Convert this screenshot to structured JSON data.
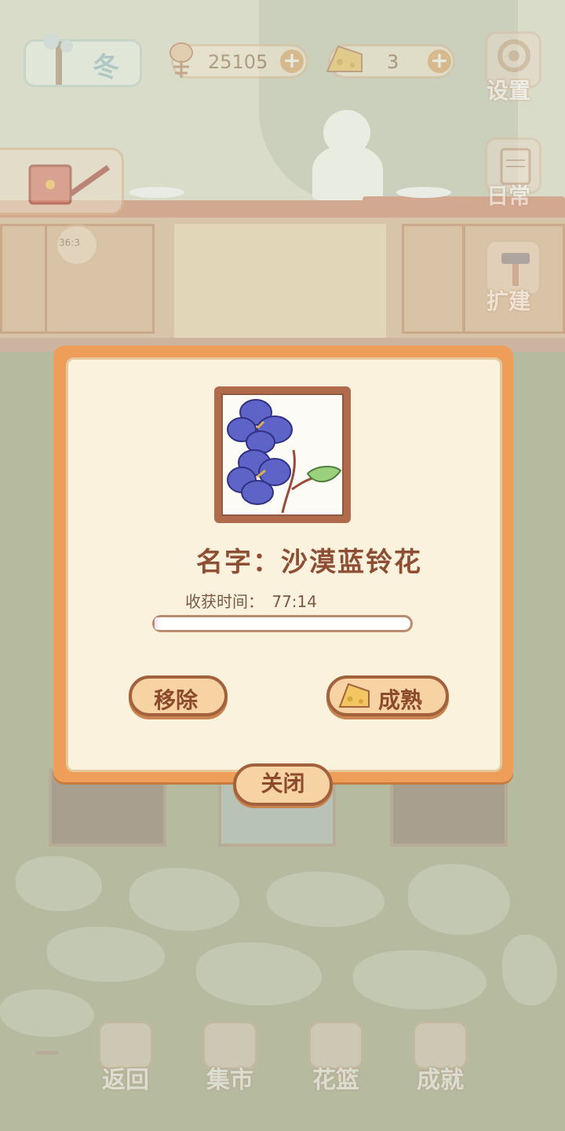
{
  "hud": {
    "season": "冬",
    "fish_count": "25105",
    "cheese_count": "3",
    "settings_label": "设置",
    "daily_label": "日常",
    "expand_label": "扩建",
    "clock_value": "36:3"
  },
  "modal": {
    "name_label": "名字：",
    "name_value": "沙漠蓝铃花",
    "time_label": "收获时间：",
    "time_value": "77:14",
    "progress_fraction": 0.02,
    "remove_label": "移除",
    "ripen_label": "成熟",
    "close_label": "关闭"
  },
  "bottom_nav": {
    "back_label": "返回",
    "market_label": "集市",
    "basket_label": "花篮",
    "achievement_label": "成就"
  },
  "colors": {
    "modal_border": "#ef9e5a",
    "modal_bg": "#fbf2dd",
    "text_brown": "#8e4e34",
    "flower_blue": "#5e63c7"
  }
}
